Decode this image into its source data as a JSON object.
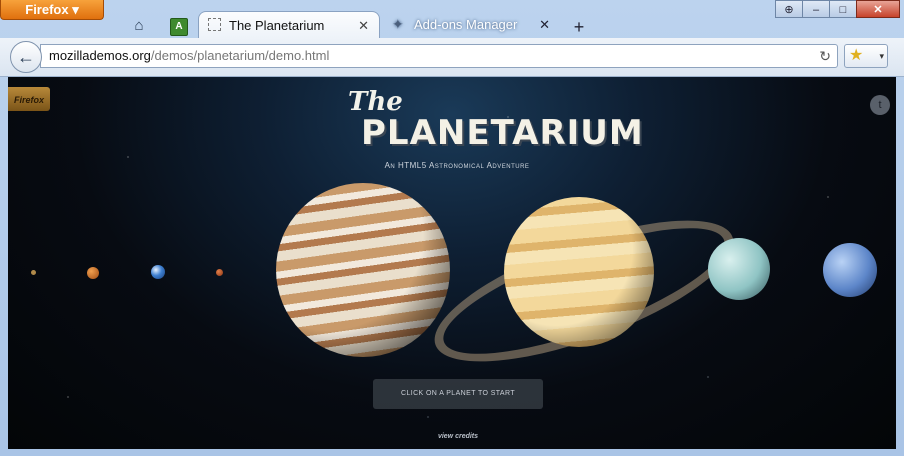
{
  "window": {
    "app_button": "Firefox ▾",
    "controls": {
      "move": "⊕",
      "minimize": "–",
      "maximize": "□",
      "close": "✕"
    }
  },
  "tabs": [
    {
      "label": "The Planetarium",
      "active": true,
      "close": "✕"
    },
    {
      "label": "Add-ons Manager",
      "active": false,
      "close": "✕"
    }
  ],
  "toolbar": {
    "home_icon": "⌂",
    "app_tab_icon": "A",
    "new_tab": "+",
    "back_icon": "←",
    "url_host": "mozillademos.org",
    "url_path": "/demos/planetarium/demo.html",
    "reload_icon": "↻",
    "bookmark_star": "★",
    "bookmark_dropdown": "▾"
  },
  "page": {
    "ribbon": "Firefox",
    "twitter_icon": "t",
    "title_the": "The",
    "title_main": "PLANETARIUM",
    "subtitle": "An HTML5 Astronomical Adventure",
    "start_button": "CLICK ON A PLANET TO START",
    "credits_link": "view credits"
  }
}
